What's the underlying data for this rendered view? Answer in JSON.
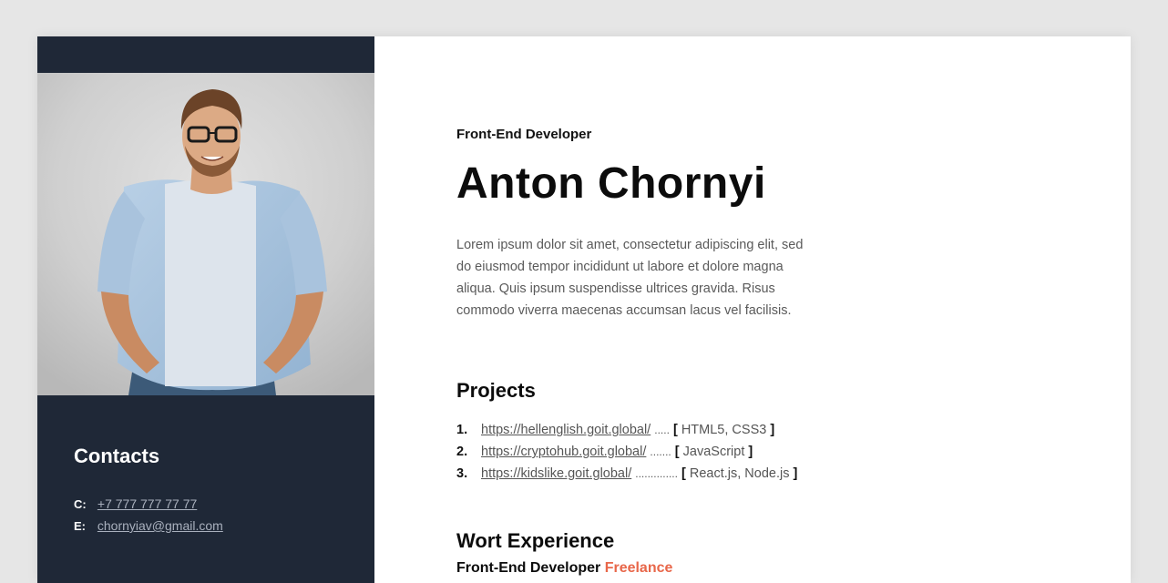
{
  "sidebar": {
    "contacts_title": "Contacts",
    "contacts": [
      {
        "key": "C:",
        "value": "+7 777 777 77 77"
      },
      {
        "key": "E:",
        "value": "chornyiav@gmail.com"
      }
    ]
  },
  "main": {
    "job_title": "Front-End Developer",
    "name": "Anton Chornyi",
    "bio": "Lorem ipsum dolor sit amet, consectetur adipiscing elit, sed do eiusmod tempor incididunt ut labore et dolore magna aliqua. Quis ipsum suspendisse ultrices gravida. Risus commodo viverra maecenas accumsan lacus vel facilisis.",
    "projects_title": "Projects",
    "projects": [
      {
        "num": "1.",
        "url": "https://hellenglish.goit.global/",
        "dots": ".....",
        "open": "[",
        "tech": "HTML5, CSS3",
        "close": "]"
      },
      {
        "num": "2.",
        "url": "https://cryptohub.goit.global/",
        "dots": ".......",
        "open": "[",
        "tech": "JavaScript",
        "close": "]"
      },
      {
        "num": "3.",
        "url": "https://kidslike.goit.global/",
        "dots": "..............",
        "open": "[",
        "tech": "React.js, Node.js",
        "close": "]"
      }
    ],
    "experience_title": "Wort Experience",
    "experience_role": "Front-End Developer",
    "experience_type": "Freelance"
  },
  "colors": {
    "sidebar_bg": "#1f2837",
    "accent": "#e8674a",
    "page_bg": "#e6e6e6"
  }
}
